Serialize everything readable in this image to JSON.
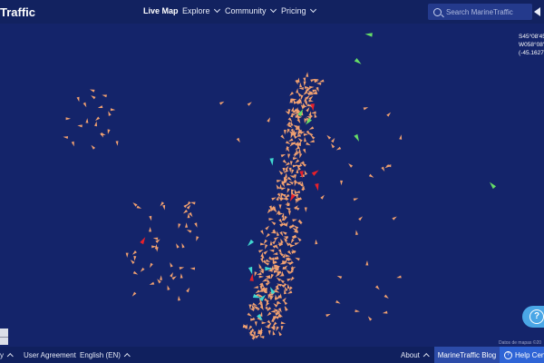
{
  "header": {
    "logo_text": "Traffic",
    "nav": [
      {
        "label": "Live Map",
        "active": true
      },
      {
        "label": "Explore",
        "active": false
      },
      {
        "label": "Community",
        "active": false
      },
      {
        "label": "Pricing",
        "active": false
      }
    ],
    "search_placeholder": "Search MarineTraffic"
  },
  "map": {
    "coords": [
      "S45°08'45",
      "W058°08'4",
      "(-45.1627,"
    ],
    "attribution": "Datos de mapas ©20"
  },
  "footer": {
    "left_fragment": "y",
    "user_agreement": "User Agreement",
    "language": "English (EN)",
    "about": "About",
    "blog": "MarineTraffic Blog",
    "help": "Help Cent"
  },
  "colors": {
    "ocean": "#14246a",
    "header": "#122260",
    "cargo_vessel": "#f0a070",
    "tanker_vessel": "#e8202a",
    "passenger_vessel": "#40d8d0",
    "fishing_vessel": "#66dd66",
    "help_button": "#4aa6e6"
  }
}
